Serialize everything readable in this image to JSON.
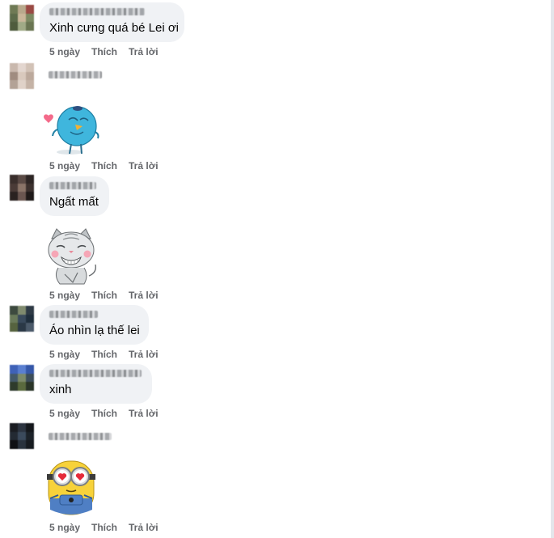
{
  "comments": [
    {
      "id": 1,
      "text": "Xinh cưng quá bé Lei ơi",
      "time": "5 ngày",
      "like": "Thích",
      "reply": "Trả lời"
    },
    {
      "id": 2,
      "sticker": "blue-bird-sticker",
      "time": "5 ngày",
      "like": "Thích",
      "reply": "Trả lời"
    },
    {
      "id": 3,
      "text": "Ngất mất",
      "sticker": "gray-cat-sticker",
      "time": "5 ngày",
      "like": "Thích",
      "reply": "Trả lời"
    },
    {
      "id": 4,
      "text": "Áo nhìn lạ thế lei",
      "time": "5 ngày",
      "like": "Thích",
      "reply": "Trả lời"
    },
    {
      "id": 5,
      "text": "xinh",
      "time": "5 ngày",
      "like": "Thích",
      "reply": "Trả lời"
    },
    {
      "id": 6,
      "sticker": "minion-heart-eyes-sticker",
      "time": "5 ngày",
      "like": "Thích",
      "reply": "Trả lời"
    }
  ],
  "colors": {
    "bubble": "#f0f2f5",
    "meta_text": "#65676b",
    "text": "#050505"
  }
}
